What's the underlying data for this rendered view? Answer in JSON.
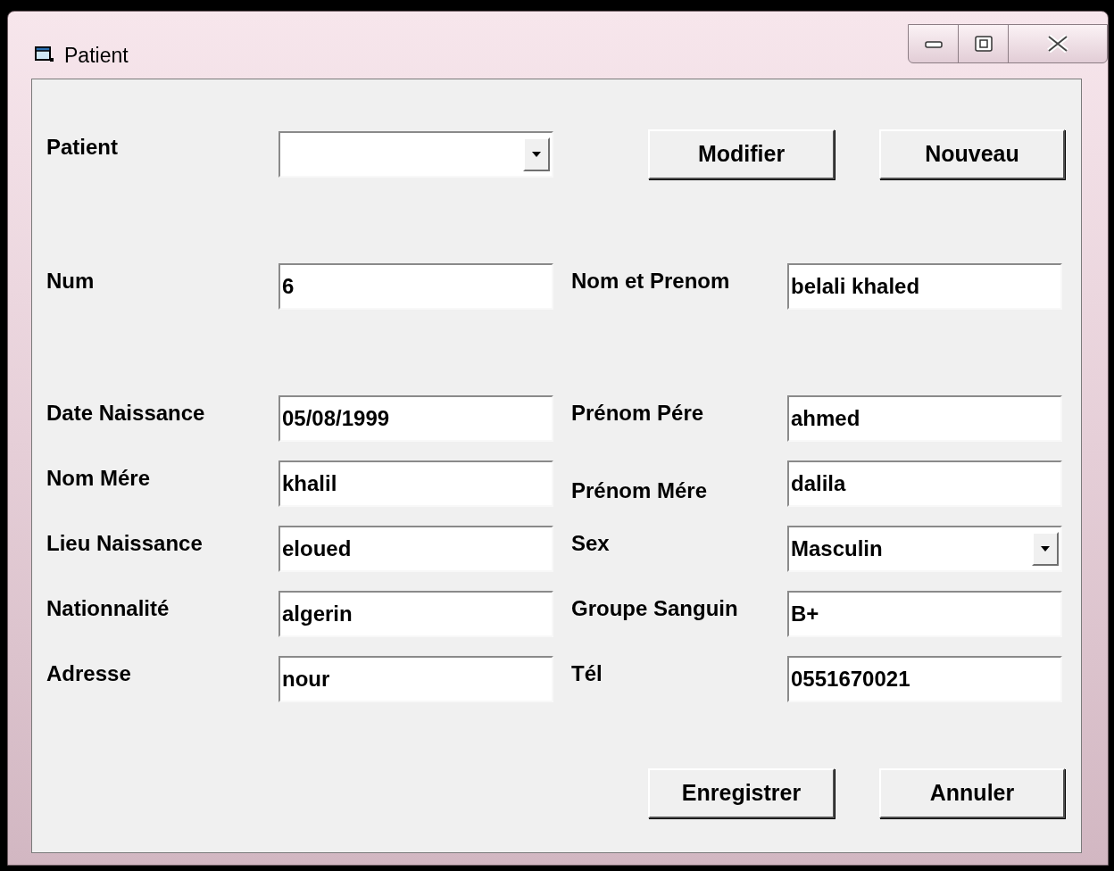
{
  "window": {
    "title": "Patient"
  },
  "patient_select": {
    "label": "Patient",
    "kind": "combo"
  },
  "top_buttons": [
    "Modifier",
    "Nouveau"
  ],
  "rows": [
    {
      "left": {
        "label": "Num",
        "value": "6",
        "kind": "text"
      },
      "right": {
        "label": "Nom et Prenom",
        "value": "belali khaled",
        "kind": "text"
      }
    },
    {
      "left": {
        "label": "Date Naissance",
        "value": "05/08/1999",
        "kind": "text"
      },
      "right": {
        "label": "Prénom Pére",
        "value": "ahmed",
        "kind": "text"
      }
    },
    {
      "left": {
        "label": "Nom Mére",
        "value": "khalil",
        "kind": "text"
      },
      "right": {
        "label": "Prénom Mére",
        "value": "dalila",
        "kind": "text"
      }
    },
    {
      "left": {
        "label": "Lieu Naissance",
        "value": "eloued",
        "kind": "text"
      },
      "right": {
        "label": "Sex",
        "value": "Masculin",
        "kind": "combo"
      }
    },
    {
      "left": {
        "label": "Nationnalité",
        "value": "algerin",
        "kind": "text"
      },
      "right": {
        "label": "Groupe Sanguin",
        "value": "B+",
        "kind": "text"
      }
    },
    {
      "left": {
        "label": "Adresse",
        "value": "nour",
        "kind": "text"
      },
      "right": {
        "label": "Tél",
        "value": "0551670021",
        "kind": "text"
      }
    }
  ],
  "bottom_buttons": [
    "Enregistrer",
    "Annuler"
  ]
}
